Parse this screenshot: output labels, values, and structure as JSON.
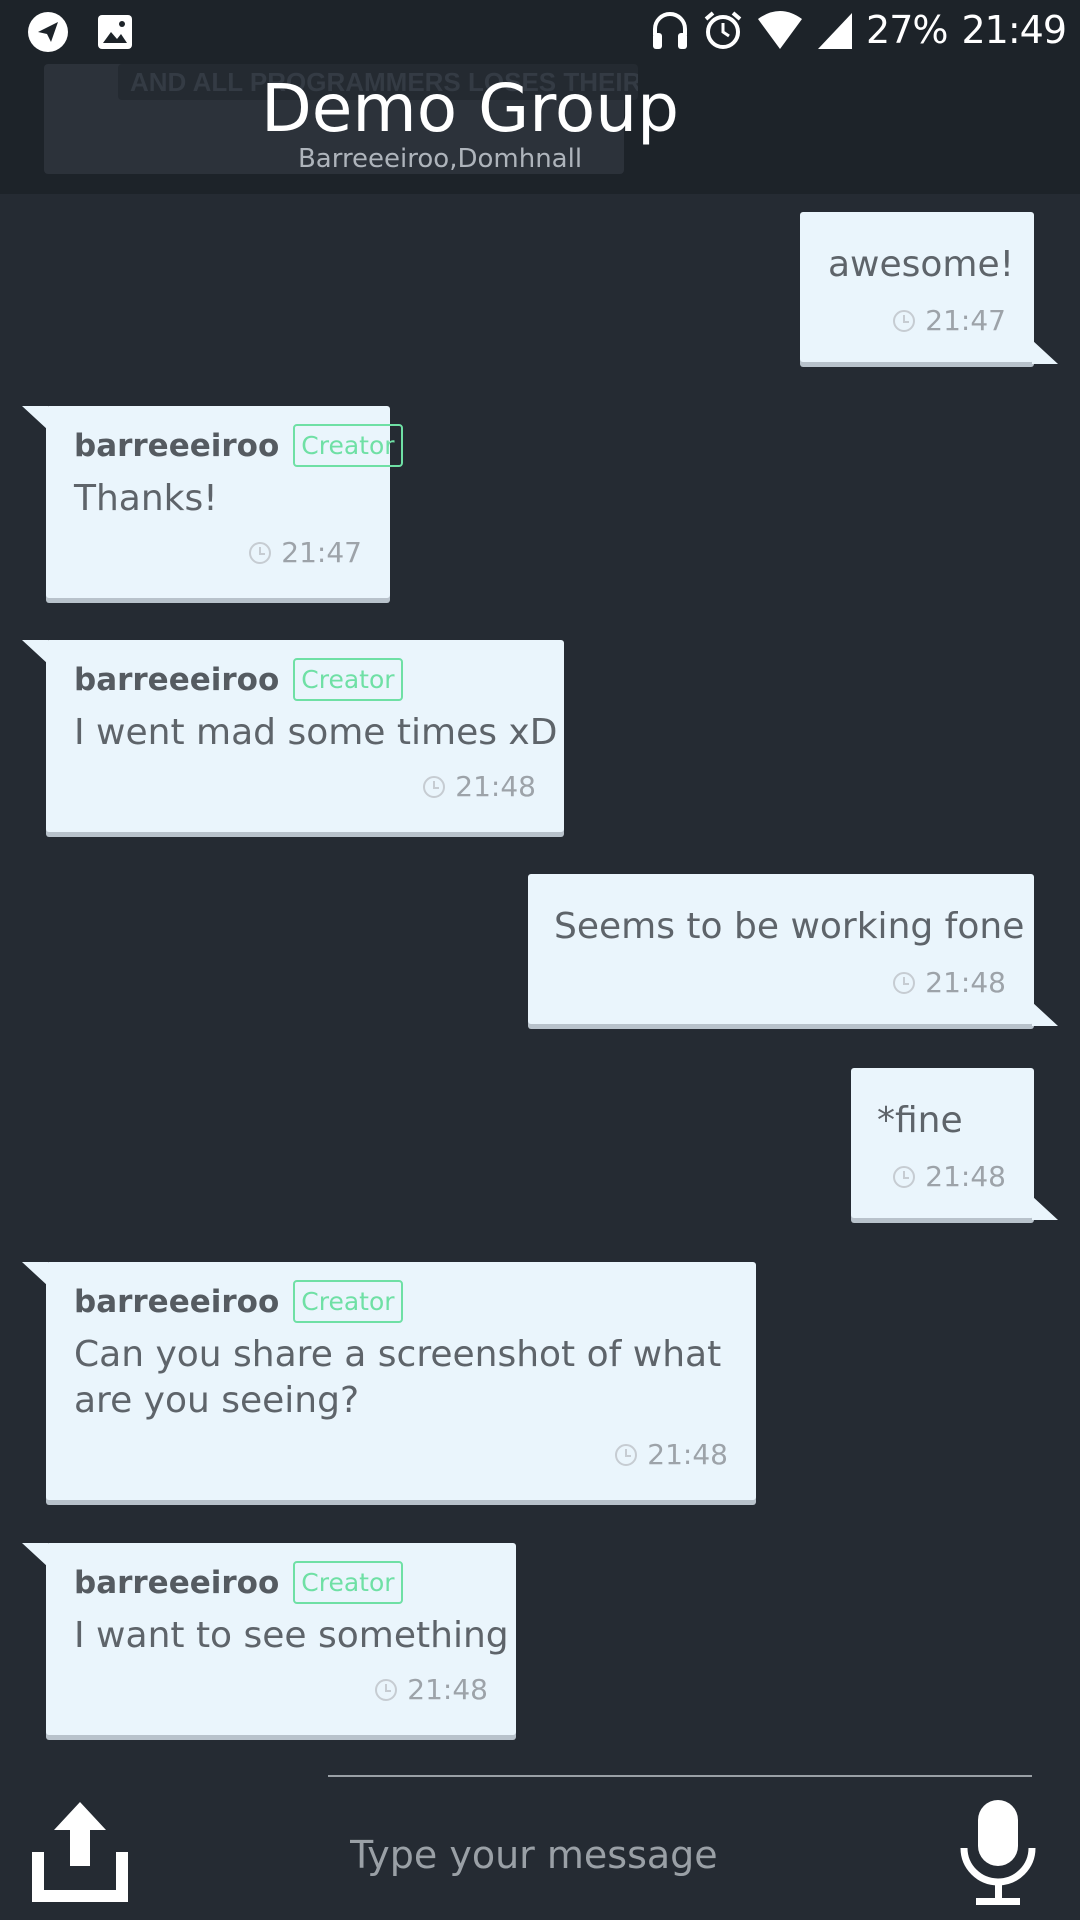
{
  "status_bar": {
    "battery": "27%",
    "time": "21:49",
    "icons": [
      "telegram-icon",
      "image-icon",
      "headphones-icon",
      "alarm-icon",
      "wifi-icon",
      "signal-icon"
    ]
  },
  "header": {
    "banner_text": "AND ALL PROGRAMMERS LOSES THEIR MINDS",
    "title": "Demo Group",
    "subtitle": "Barreeeiroo,Domhnall"
  },
  "messages": [
    {
      "direction": "out",
      "text": "awesome!",
      "time": "21:47"
    },
    {
      "direction": "in",
      "sender": "barreeeiroo",
      "badge": "Creator",
      "text": "Thanks!",
      "time": "21:47"
    },
    {
      "direction": "in",
      "sender": "barreeeiroo",
      "badge": "Creator",
      "text": "I went mad some times xD",
      "time": "21:48"
    },
    {
      "direction": "out",
      "text": "Seems to be working fone",
      "time": "21:48"
    },
    {
      "direction": "out",
      "text": "*fine",
      "time": "21:48"
    },
    {
      "direction": "in",
      "sender": "barreeeiroo",
      "badge": "Creator",
      "text_line1": "Can you share a screenshot of what",
      "text_line2": "are you seeing?",
      "time": "21:48"
    },
    {
      "direction": "in",
      "sender": "barreeeiroo",
      "badge": "Creator",
      "text": "I want to see something",
      "time": "21:48"
    }
  ],
  "composer": {
    "placeholder": "Type your message",
    "share_icon": "share-upload-icon",
    "mic_icon": "microphone-icon"
  },
  "colors": {
    "background": "#252b33",
    "header": "#1d2329",
    "bubble": "#eaf5fc",
    "creator_badge": "#6fe0a5"
  }
}
